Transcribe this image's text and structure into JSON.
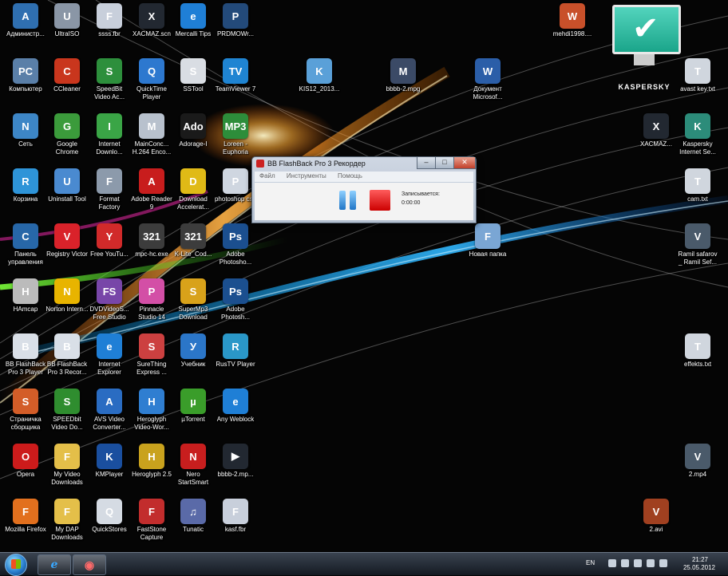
{
  "desktop": {
    "columns": [
      [
        {
          "label": "Администр...",
          "icon": "admin-user-icon",
          "color": "#2f6fb0",
          "glyph": "A"
        },
        {
          "label": "Компьютер",
          "icon": "computer-icon",
          "color": "#5a7fa8",
          "glyph": "PC"
        },
        {
          "label": "Сеть",
          "icon": "network-icon",
          "color": "#3d86c6",
          "glyph": "N"
        },
        {
          "label": "Корзина",
          "icon": "recycle-bin-icon",
          "color": "#2e94d8",
          "glyph": "R"
        },
        {
          "label": "Панель управления",
          "icon": "control-panel-icon",
          "color": "#2767a8",
          "glyph": "C"
        },
        {
          "label": "HAmcap",
          "icon": "hamcap-icon",
          "color": "#bbbbbb",
          "glyph": "H"
        },
        {
          "label": "BB FlashBack Pro 3 Player",
          "icon": "bb-flashback-player-icon",
          "color": "#d9dfe7",
          "glyph": "B"
        },
        {
          "label": "Страничка сборщика",
          "icon": "page-builder-icon",
          "color": "#d35d28",
          "glyph": "S"
        },
        {
          "label": "Opera",
          "icon": "opera-icon",
          "color": "#cc1b1b",
          "glyph": "O"
        },
        {
          "label": "Mozilla Firefox",
          "icon": "firefox-icon",
          "color": "#e2701e",
          "glyph": "F"
        }
      ],
      [
        {
          "label": "UltraISO",
          "icon": "ultraiso-icon",
          "color": "#8a96a6",
          "glyph": "U"
        },
        {
          "label": "CCleaner",
          "icon": "ccleaner-icon",
          "color": "#c9361d",
          "glyph": "C"
        },
        {
          "label": "Google Chrome",
          "icon": "chrome-icon",
          "color": "#3b9b3b",
          "glyph": "G"
        },
        {
          "label": "Uninstall Tool",
          "icon": "uninstall-tool-icon",
          "color": "#4a8ad0",
          "glyph": "U"
        },
        {
          "label": "Registry Victor",
          "icon": "registry-victor-icon",
          "color": "#d9222a",
          "glyph": "V"
        },
        {
          "label": "Norton Intern...",
          "icon": "norton-icon",
          "color": "#e8b400",
          "glyph": "N"
        },
        {
          "label": "BB FlashBack Pro 3 Recor...",
          "icon": "bb-flashback-recorder-icon",
          "color": "#d9dfe7",
          "glyph": "B"
        },
        {
          "label": "SPEEDbit Video Do...",
          "icon": "speedbit-icon",
          "color": "#2f8d2f",
          "glyph": "S"
        },
        {
          "label": "My Video Downloads",
          "icon": "folder-icon",
          "color": "#e4bf49",
          "glyph": "F"
        },
        {
          "label": "My DAP Downloads",
          "icon": "folder-icon",
          "color": "#e4bf49",
          "glyph": "F"
        }
      ],
      [
        {
          "label": "ssss.fbr",
          "icon": "fbr-file-icon",
          "color": "#c8cfdb",
          "glyph": "F"
        },
        {
          "label": "SpeedBit Video Ac...",
          "icon": "speedbit-accelerator-icon",
          "color": "#2d8f3c",
          "glyph": "S"
        },
        {
          "label": "Internet Downlo...",
          "icon": "internet-download-icon",
          "color": "#3aa546",
          "glyph": "I"
        },
        {
          "label": "Format Factory",
          "icon": "format-factory-icon",
          "color": "#8c9aab",
          "glyph": "F"
        },
        {
          "label": "Free YouTu...",
          "icon": "youtube-downloader-icon",
          "color": "#d12a2a",
          "glyph": "Y"
        },
        {
          "label": "DVDVideoS... Free Studio",
          "icon": "dvdvideosoft-icon",
          "color": "#7846a8",
          "glyph": "FS"
        },
        {
          "label": "Internet Explorer",
          "icon": "internet-explorer-icon",
          "color": "#1f7fd6",
          "glyph": "e"
        },
        {
          "label": "AVS Video Converter...",
          "icon": "avs-converter-icon",
          "color": "#2a6cc2",
          "glyph": "A"
        },
        {
          "label": "KMPlayer",
          "icon": "kmplayer-icon",
          "color": "#1a4f9f",
          "glyph": "K"
        },
        {
          "label": "QuickStores",
          "icon": "quickstores-icon",
          "color": "#d5dbe3",
          "glyph": "Q"
        }
      ],
      [
        {
          "label": "XACMAZ.scn",
          "icon": "scn-file-icon",
          "color": "#222831",
          "glyph": "X"
        },
        {
          "label": "QuickTime Player",
          "icon": "quicktime-icon",
          "color": "#2d78cf",
          "glyph": "Q"
        },
        {
          "label": "MainConc... H.264 Enco...",
          "icon": "mainconcept-icon",
          "color": "#b8c1cd",
          "glyph": "M"
        },
        {
          "label": "Adobe Reader 9",
          "icon": "adobe-reader-icon",
          "color": "#c81d1d",
          "glyph": "A"
        },
        {
          "label": "mpc-hc.exe",
          "icon": "mpc-hc-icon",
          "color": "#3c3c3c",
          "glyph": "321"
        },
        {
          "label": "Pinnacle Studio 14",
          "icon": "pinnacle-icon",
          "color": "#d34fa6",
          "glyph": "P"
        },
        {
          "label": "SureThing Express ...",
          "icon": "surething-icon",
          "color": "#cc4040",
          "glyph": "S"
        },
        {
          "label": "Heroglyph Video-Wor...",
          "icon": "heroglyph-icon",
          "color": "#2f7ed1",
          "glyph": "H"
        },
        {
          "label": "Heroglyph 2.5",
          "icon": "heroglyph-icon",
          "color": "#c9a21d",
          "glyph": "H"
        },
        {
          "label": "FastStone Capture",
          "icon": "faststone-icon",
          "color": "#c22d2d",
          "glyph": "F"
        }
      ],
      [
        {
          "label": "Mercalli Tips",
          "icon": "ie-shortcut-icon",
          "color": "#1f7fd6",
          "glyph": "e"
        },
        {
          "label": "SSTool",
          "icon": "sstool-icon",
          "color": "#d9dde3",
          "glyph": "S"
        },
        {
          "label": "Adorage-I",
          "icon": "adorage-icon",
          "color": "#1a1a1a",
          "glyph": "Ado"
        },
        {
          "label": "Download Accelerat...",
          "icon": "download-accelerator-icon",
          "color": "#e0ba16",
          "glyph": "D"
        },
        {
          "label": "K-Lite_Cod...",
          "icon": "klite-icon",
          "color": "#3c3c3c",
          "glyph": "321"
        },
        {
          "label": "SuperMp3 Download",
          "icon": "supermp3-icon",
          "color": "#d8a21a",
          "glyph": "S"
        },
        {
          "label": "Учебник",
          "icon": "tutorial-icon",
          "color": "#2b76c8",
          "glyph": "У"
        },
        {
          "label": "µTorrent",
          "icon": "utorrent-icon",
          "color": "#3a9d2a",
          "glyph": "µ"
        },
        {
          "label": "Nero StartSmart",
          "icon": "nero-icon",
          "color": "#c81e1e",
          "glyph": "N"
        },
        {
          "label": "Tunatic",
          "icon": "tunatic-icon",
          "color": "#5a6aa8",
          "glyph": "♫"
        }
      ],
      [
        {
          "label": "PRDMOWr...",
          "icon": "prdmo-icon",
          "color": "#234a7a",
          "glyph": "P"
        },
        {
          "label": "TeamViewer 7",
          "icon": "teamviewer-icon",
          "color": "#1f84d2",
          "glyph": "TV"
        },
        {
          "label": "Loreen - Euphoria",
          "icon": "mp3-file-icon",
          "color": "#2d8d3a",
          "glyph": "MP3"
        },
        {
          "label": "photoshop cs6",
          "icon": "photoshop-file-icon",
          "color": "#cfd6e0",
          "glyph": "P"
        },
        {
          "label": "Adobe Photosho...",
          "icon": "photoshop-icon",
          "color": "#1b4f8f",
          "glyph": "Ps"
        },
        {
          "label": "Adobe Photosh...",
          "icon": "photoshop-icon",
          "color": "#1b4f8f",
          "glyph": "Ps"
        },
        {
          "label": "RusTV Player",
          "icon": "rustv-icon",
          "color": "#2a97c8",
          "glyph": "R"
        },
        {
          "label": "Any Weblock",
          "icon": "any-weblock-icon",
          "color": "#1f7fd6",
          "glyph": "e"
        },
        {
          "label": "bbbb-2.mp...",
          "icon": "media-file-icon",
          "color": "#222831",
          "glyph": "▶"
        },
        {
          "label": "kasf.fbr",
          "icon": "fbr-file-icon",
          "color": "#c8cfdb",
          "glyph": "F"
        }
      ]
    ],
    "scattered": [
      {
        "label": "KIS12_2013...",
        "icon": "kis-archive-icon",
        "color": "#5aa0d8",
        "glyph": "K"
      },
      {
        "label": "bbbb-2.mpg",
        "icon": "mpg-file-icon",
        "color": "#3b4a66",
        "glyph": "M"
      },
      {
        "label": "Документ Microsof...",
        "icon": "word-document-icon",
        "color": "#2b5ea8",
        "glyph": "W"
      },
      {
        "label": "mehdi1998....",
        "icon": "windows-shortcut-icon",
        "color": "#c8502a",
        "glyph": "W"
      },
      {
        "label": "avast key.txt",
        "icon": "text-file-icon",
        "color": "#d0d6de",
        "glyph": "T"
      },
      {
        "label": "XACMAZ...",
        "icon": "scn-file-icon",
        "color": "#222831",
        "glyph": "X"
      },
      {
        "label": "Kaspersky Internet Se...",
        "icon": "kaspersky-shortcut-icon",
        "color": "#2c8c7a",
        "glyph": "K"
      },
      {
        "label": "cam.txt",
        "icon": "text-file-icon",
        "color": "#d0d6de",
        "glyph": "T"
      },
      {
        "label": "Новая папка",
        "icon": "new-folder-icon",
        "color": "#7aa6d4",
        "glyph": "F"
      },
      {
        "label": "Ramil safarov _ Ramil Sef...",
        "icon": "video-file-icon",
        "color": "#4a5a6a",
        "glyph": "V"
      },
      {
        "label": "effekts.txt",
        "icon": "text-file-icon",
        "color": "#d0d6de",
        "glyph": "T"
      },
      {
        "label": "2.mp4",
        "icon": "video-file-icon",
        "color": "#4a5a6a",
        "glyph": "V"
      },
      {
        "label": "2.avi",
        "icon": "video-file-icon",
        "color": "#a04020",
        "glyph": "V"
      }
    ]
  },
  "recorder": {
    "title": "BB FlashBack Pro 3 Рекордер",
    "menu": [
      "Файл",
      "Инструменты",
      "Помощь"
    ],
    "status": "Записывается:",
    "time": "0:00:00"
  },
  "kaspersky": {
    "brand": "KASPERSKY"
  },
  "taskbar": {
    "language": "EN",
    "time": "21:27",
    "date": "25.05.2012"
  }
}
